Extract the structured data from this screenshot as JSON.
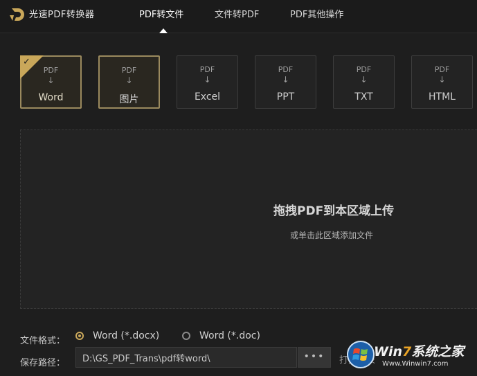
{
  "app": {
    "title": "光速PDF转换器"
  },
  "nav": {
    "tabs": [
      {
        "label": "PDF转文件",
        "active": true
      },
      {
        "label": "文件转PDF",
        "active": false
      },
      {
        "label": "PDF其他操作",
        "active": false
      }
    ]
  },
  "formats": {
    "items": [
      {
        "source": "PDF",
        "arrow": "↓",
        "target": "Word",
        "selected": true
      },
      {
        "source": "PDF",
        "arrow": "↓",
        "target": "图片",
        "selected": false
      },
      {
        "source": "PDF",
        "arrow": "↓",
        "target": "Excel",
        "selected": false
      },
      {
        "source": "PDF",
        "arrow": "↓",
        "target": "PPT",
        "selected": false
      },
      {
        "source": "PDF",
        "arrow": "↓",
        "target": "TXT",
        "selected": false
      },
      {
        "source": "PDF",
        "arrow": "↓",
        "target": "HTML",
        "selected": false
      }
    ],
    "check_mark": "✓"
  },
  "dropzone": {
    "title": "拖拽PDF到本区域上传",
    "subtitle": "或单击此区域添加文件"
  },
  "settings": {
    "format_label": "文件格式：",
    "options": [
      {
        "label": "Word (*.docx)",
        "checked": true
      },
      {
        "label": "Word (*.doc)",
        "checked": false
      }
    ],
    "path_label": "保存路径：",
    "path_value": "D:\\GS_PDF_Trans\\pdf转word\\",
    "browse_label": "•••",
    "open_dir_label": "打开目录"
  },
  "watermark": {
    "brand_prefix": "Win",
    "brand_seven": "7",
    "brand_suffix": "系统之家",
    "url": "Www.Winwin7.com"
  },
  "colors": {
    "accent": "#c9a75a",
    "background": "#1e1e1e",
    "card_border": "#3d3d3d"
  }
}
